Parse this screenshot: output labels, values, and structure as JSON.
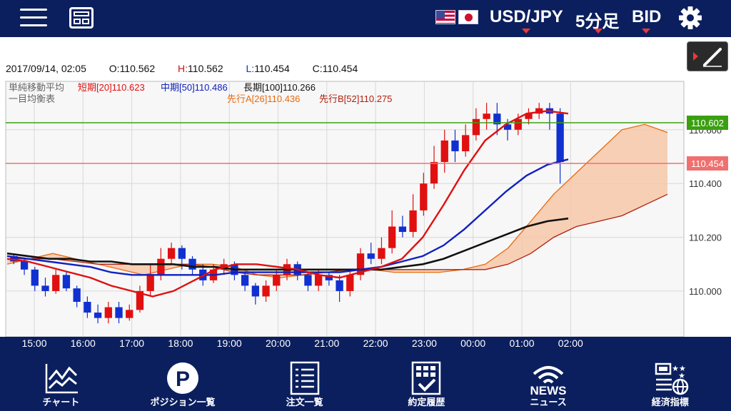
{
  "header": {
    "pair": "USD/JPY",
    "timeframe": "5分足",
    "price_type": "BID"
  },
  "info": {
    "datetime": "2017/09/14, 02:05",
    "open_label": "O:",
    "open": "110.562",
    "high_label": "H:",
    "high": "110.562",
    "low_label": "L:",
    "low": "110.454",
    "close_label": "C:",
    "close": "110.454"
  },
  "legend": {
    "sma_title": "単純移動平均",
    "sma_short": "短期[20]110.623",
    "sma_mid": "中期[50]110.486",
    "sma_long": "長期[100]110.266",
    "ichimoku_title": "一目均衡表",
    "span_a": "先行A[26]110.436",
    "span_b": "先行B[52]110.275"
  },
  "price_tags": {
    "green": "110.602",
    "red": "110.454"
  },
  "colors": {
    "sma_short": "#e01010",
    "sma_mid": "#1020c0",
    "sma_long": "#111111",
    "span_a": "#e86a10",
    "span_b": "#b02010",
    "cloud": "#f6c8a8",
    "green_line": "#3aa010",
    "red_line": "#f07070"
  },
  "chart_data": {
    "type": "candlestick",
    "y_ticks": [
      "110.600",
      "110.400",
      "110.200",
      "110.000"
    ],
    "x_ticks": [
      "15:00",
      "16:00",
      "17:00",
      "18:00",
      "19:00",
      "20:00",
      "21:00",
      "22:00",
      "23:00",
      "00:00",
      "01:00",
      "02:00"
    ],
    "ylim": [
      109.83,
      110.78
    ],
    "sma_short": [
      110.12,
      110.11,
      110.09,
      110.07,
      110.05,
      110.02,
      110.0,
      109.98,
      110.0,
      110.04,
      110.08,
      110.1,
      110.1,
      110.09,
      110.08,
      110.06,
      110.05,
      110.07,
      110.09,
      110.12,
      110.2,
      110.32,
      110.45,
      110.56,
      110.62,
      110.66,
      110.67,
      110.66
    ],
    "sma_mid": [
      110.13,
      110.12,
      110.11,
      110.1,
      110.09,
      110.07,
      110.06,
      110.06,
      110.06,
      110.06,
      110.06,
      110.07,
      110.07,
      110.07,
      110.07,
      110.07,
      110.07,
      110.08,
      110.09,
      110.11,
      110.13,
      110.17,
      110.23,
      110.3,
      110.37,
      110.43,
      110.47,
      110.49
    ],
    "sma_long": [
      110.14,
      110.13,
      110.12,
      110.12,
      110.11,
      110.11,
      110.1,
      110.1,
      110.1,
      110.09,
      110.09,
      110.08,
      110.08,
      110.08,
      110.08,
      110.08,
      110.08,
      110.08,
      110.08,
      110.09,
      110.1,
      110.12,
      110.15,
      110.18,
      110.21,
      110.24,
      110.26,
      110.27
    ],
    "span_a": [
      110.1,
      110.12,
      110.14,
      110.12,
      110.1,
      110.08,
      110.06,
      110.08,
      110.1,
      110.1,
      110.09,
      110.06,
      110.05,
      110.06,
      110.07,
      110.08,
      110.08,
      110.07,
      110.07,
      110.07,
      110.08,
      110.1,
      110.16,
      110.26,
      110.36,
      110.44,
      110.52,
      110.6,
      110.62,
      110.59
    ],
    "span_b": [
      110.12,
      110.12,
      110.12,
      110.11,
      110.1,
      110.1,
      110.1,
      110.1,
      110.1,
      110.09,
      110.07,
      110.06,
      110.06,
      110.06,
      110.07,
      110.08,
      110.08,
      110.08,
      110.08,
      110.08,
      110.08,
      110.08,
      110.1,
      110.14,
      110.2,
      110.24,
      110.26,
      110.28,
      110.32,
      110.36
    ],
    "candles": [
      [
        110.13,
        110.11,
        110.14,
        110.1
      ],
      [
        110.11,
        110.08,
        110.12,
        110.06
      ],
      [
        110.08,
        110.02,
        110.09,
        110.0
      ],
      [
        110.02,
        110.0,
        110.05,
        109.98
      ],
      [
        110.0,
        110.06,
        110.08,
        109.99
      ],
      [
        110.06,
        110.01,
        110.07,
        110.0
      ],
      [
        110.01,
        109.96,
        110.02,
        109.94
      ],
      [
        109.96,
        109.92,
        109.98,
        109.9
      ],
      [
        109.92,
        109.9,
        109.95,
        109.88
      ],
      [
        109.9,
        109.94,
        109.96,
        109.88
      ],
      [
        109.94,
        109.9,
        109.96,
        109.88
      ],
      [
        109.9,
        109.93,
        109.95,
        109.89
      ],
      [
        109.93,
        110.0,
        110.02,
        109.92
      ],
      [
        110.0,
        110.06,
        110.1,
        109.98
      ],
      [
        110.06,
        110.12,
        110.16,
        110.04
      ],
      [
        110.12,
        110.16,
        110.18,
        110.1
      ],
      [
        110.16,
        110.12,
        110.17,
        110.08
      ],
      [
        110.12,
        110.08,
        110.13,
        110.06
      ],
      [
        110.08,
        110.04,
        110.1,
        110.02
      ],
      [
        110.04,
        110.08,
        110.1,
        110.03
      ],
      [
        110.08,
        110.1,
        110.12,
        110.06
      ],
      [
        110.1,
        110.06,
        110.11,
        110.04
      ],
      [
        110.06,
        110.02,
        110.07,
        110.0
      ],
      [
        110.02,
        109.98,
        110.03,
        109.95
      ],
      [
        109.98,
        110.02,
        110.04,
        109.96
      ],
      [
        110.02,
        110.06,
        110.08,
        110.0
      ],
      [
        110.06,
        110.1,
        110.12,
        110.04
      ],
      [
        110.1,
        110.06,
        110.11,
        110.04
      ],
      [
        110.06,
        110.02,
        110.07,
        110.0
      ],
      [
        110.02,
        110.06,
        110.08,
        110.0
      ],
      [
        110.06,
        110.04,
        110.07,
        110.02
      ],
      [
        110.04,
        110.0,
        110.06,
        109.96
      ],
      [
        110.0,
        110.06,
        110.08,
        109.98
      ],
      [
        110.06,
        110.14,
        110.16,
        110.04
      ],
      [
        110.14,
        110.12,
        110.18,
        110.1
      ],
      [
        110.12,
        110.16,
        110.2,
        110.1
      ],
      [
        110.16,
        110.24,
        110.3,
        110.14
      ],
      [
        110.24,
        110.22,
        110.28,
        110.2
      ],
      [
        110.22,
        110.3,
        110.36,
        110.2
      ],
      [
        110.3,
        110.4,
        110.44,
        110.28
      ],
      [
        110.4,
        110.48,
        110.54,
        110.38
      ],
      [
        110.48,
        110.56,
        110.6,
        110.44
      ],
      [
        110.56,
        110.52,
        110.6,
        110.48
      ],
      [
        110.52,
        110.58,
        110.62,
        110.5
      ],
      [
        110.58,
        110.64,
        110.68,
        110.56
      ],
      [
        110.64,
        110.66,
        110.7,
        110.6
      ],
      [
        110.66,
        110.62,
        110.7,
        110.58
      ],
      [
        110.62,
        110.6,
        110.64,
        110.56
      ],
      [
        110.6,
        110.64,
        110.66,
        110.58
      ],
      [
        110.64,
        110.66,
        110.68,
        110.62
      ],
      [
        110.66,
        110.68,
        110.7,
        110.64
      ],
      [
        110.68,
        110.66,
        110.7,
        110.6
      ],
      [
        110.66,
        110.48,
        110.68,
        110.4
      ]
    ]
  },
  "nav": [
    {
      "label": "チャート"
    },
    {
      "label": "ポジション一覧"
    },
    {
      "label": "注文一覧"
    },
    {
      "label": "約定履歴"
    },
    {
      "label": "ニュース",
      "sub": "NEWS"
    },
    {
      "label": "経済指標"
    }
  ]
}
